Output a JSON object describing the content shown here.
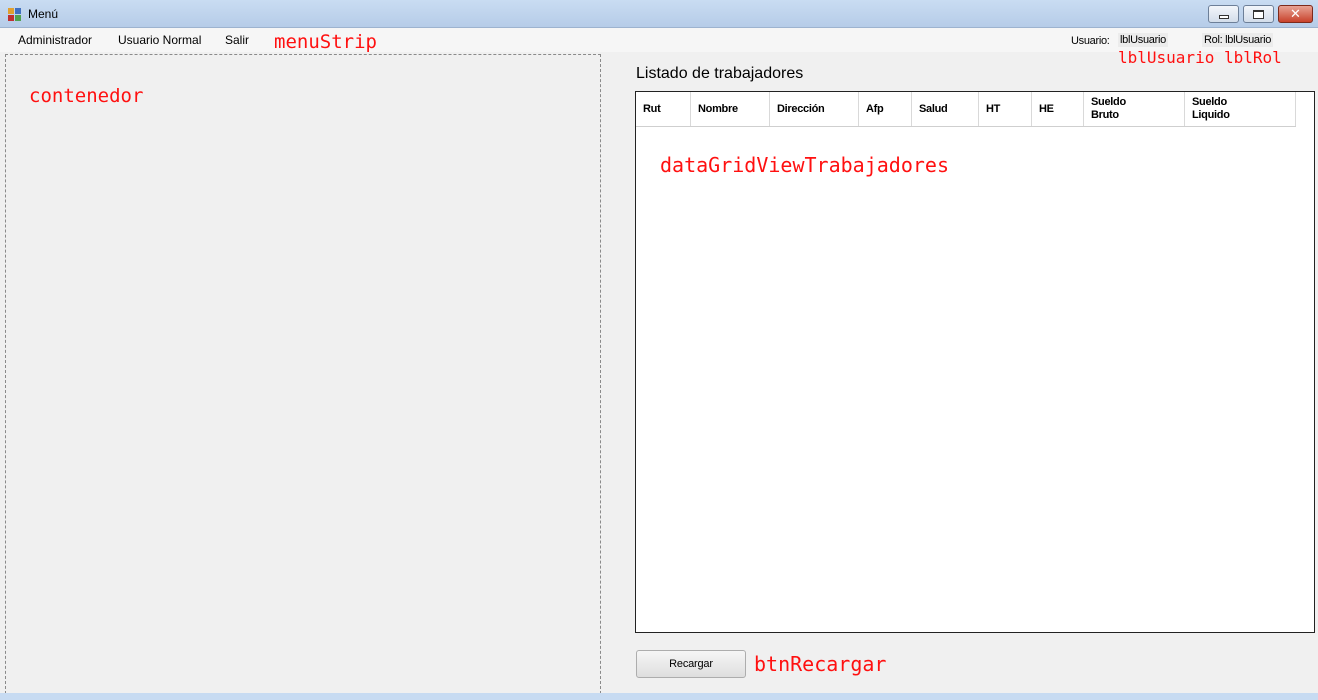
{
  "window": {
    "title": "Menú"
  },
  "menu": {
    "items": [
      {
        "label": "Administrador"
      },
      {
        "label": "Usuario Normal"
      },
      {
        "label": "Salir"
      }
    ]
  },
  "status": {
    "usuario_prefix": "Usuario:",
    "usuario_value": "lblUsuario",
    "rol_text": "Rol: lblUsuario"
  },
  "main": {
    "listado_title": "Listado de trabajadores",
    "grid_columns": [
      {
        "label": "Rut"
      },
      {
        "label": "Nombre"
      },
      {
        "label": "Dirección"
      },
      {
        "label": "Afp"
      },
      {
        "label": "Salud"
      },
      {
        "label": "HT"
      },
      {
        "label": "HE"
      },
      {
        "label": "Sueldo\nBruto"
      },
      {
        "label": "Sueldo\nLiquido"
      }
    ],
    "reload_button": "Recargar"
  },
  "annotations": {
    "menustrip": "menuStrip",
    "lbls": "lblUsuario lblRol",
    "contenedor": "contenedor",
    "grid": "dataGridViewTrabajadores",
    "button": "btnRecargar"
  },
  "colors": {
    "annotation": "#ff1010",
    "titlebar": "#c3d7ef",
    "form_background": "#f0f0f0"
  }
}
